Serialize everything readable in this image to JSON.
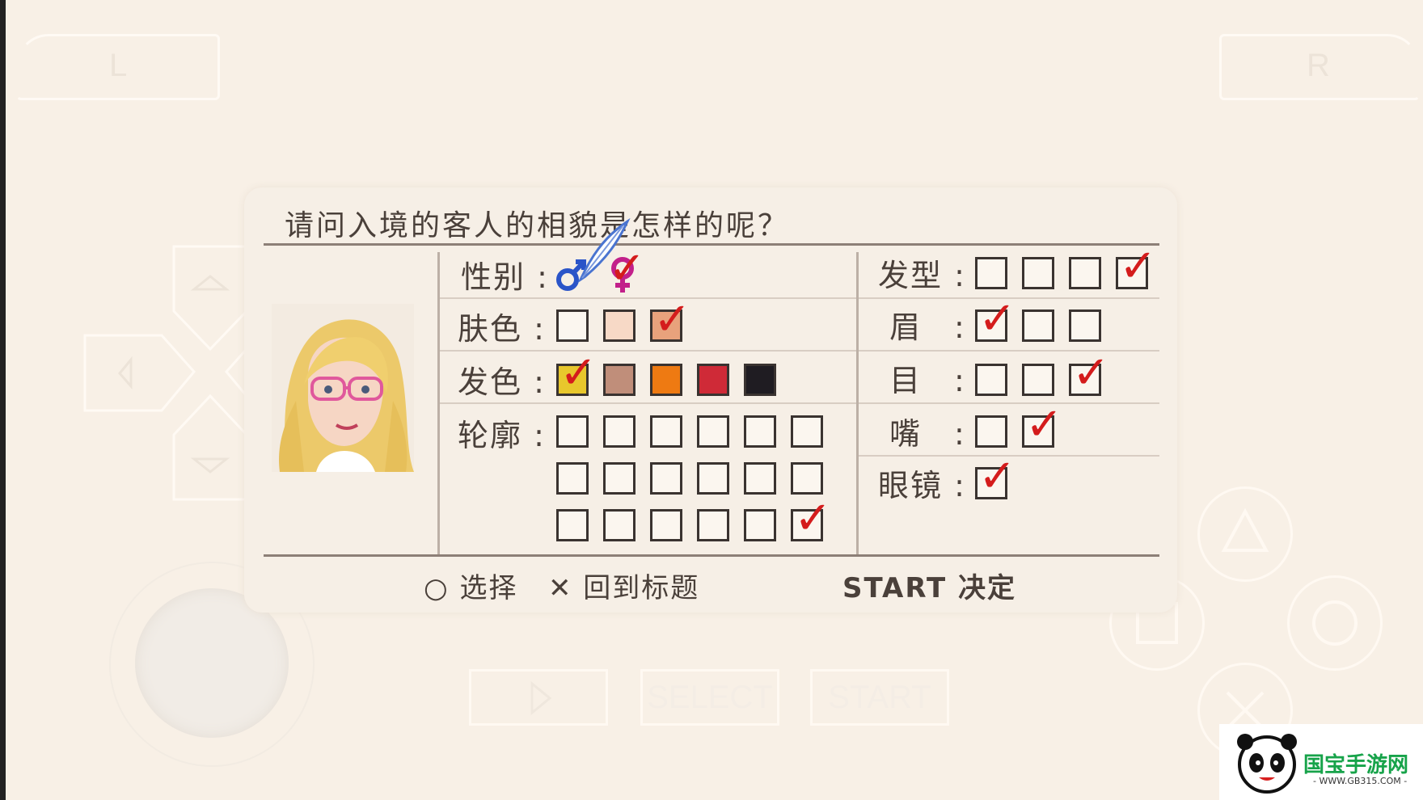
{
  "controls": {
    "shoulder_left": "L",
    "shoulder_right": "R",
    "select_label": "SELECT",
    "start_label": "START"
  },
  "dialog": {
    "title": "请问入境的客人的相貌是怎样的呢？",
    "rows_left": [
      {
        "label": "性别 :",
        "type": "gender",
        "options": [
          "♂",
          "♀"
        ],
        "selected": 1
      },
      {
        "label": "肤色 :",
        "type": "skin",
        "colors": [
          "#fbf6ef",
          "#f7d9c6",
          "#e8a27c"
        ],
        "selected": 2
      },
      {
        "label": "发色 :",
        "type": "hair",
        "colors": [
          "#e8c72c",
          "#c08e7a",
          "#ee7a12",
          "#cf2a37",
          "#1f1c22"
        ],
        "selected": 0
      },
      {
        "label": "轮廓 :",
        "type": "face",
        "count": 18,
        "selected": 17
      }
    ],
    "rows_right": [
      {
        "label": "发型 :",
        "count": 4,
        "selected": 3
      },
      {
        "label": "眉　:",
        "count": 3,
        "selected": 0
      },
      {
        "label": "目　:",
        "count": 3,
        "selected": 2
      },
      {
        "label": "嘴　:",
        "count": 2,
        "selected": 1
      },
      {
        "label": "眼镜 :",
        "count": 1,
        "selected": 0
      }
    ],
    "footer": {
      "select": "○ 选择",
      "back": "✕ 回到标题",
      "confirm": "START 决定"
    }
  },
  "watermark": {
    "title": "国宝手游网",
    "url": "- WWW.GB315.COM -"
  },
  "colors": {
    "background": "#f8f0e6",
    "check": "#d41c1c",
    "male_icon": "#2a54c8",
    "female_icon": "#c2208a"
  }
}
